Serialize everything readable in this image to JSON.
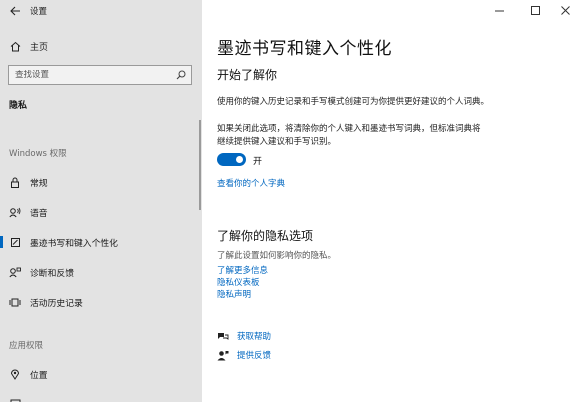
{
  "app": {
    "title": "设置"
  },
  "sidebar": {
    "home_label": "主页",
    "search_placeholder": "查找设置",
    "current_section": "隐私",
    "group_windows": "Windows 权限",
    "items": [
      {
        "label": "常规",
        "icon": "lock-icon"
      },
      {
        "label": "语音",
        "icon": "speech-icon"
      },
      {
        "label": "墨迹书写和键入个性化",
        "icon": "ink-icon",
        "active": true
      },
      {
        "label": "诊断和反馈",
        "icon": "diagnostics-icon"
      },
      {
        "label": "活动历史记录",
        "icon": "activity-history-icon"
      }
    ],
    "group_app": "应用权限",
    "app_items": [
      {
        "label": "位置",
        "icon": "location-icon"
      }
    ]
  },
  "main": {
    "title": "墨迹书写和键入个性化",
    "getting_to_know": {
      "title": "开始了解你",
      "desc1": "使用你的键入历史记录和手写模式创建可为你提供更好建议的个人词典。",
      "desc2_line1": "如果关闭此选项，将清除你的个人键入和墨迹书写词典，但标准词典将",
      "desc2_line2": "继续提供键入建议和手写识别。",
      "toggle_state": "开",
      "toggle_on": true,
      "link": "查看你的个人字典"
    },
    "privacy": {
      "title": "了解你的隐私选项",
      "desc": "了解此设置如何影响你的隐私。",
      "links": [
        "了解更多信息",
        "隐私仪表板",
        "隐私声明"
      ]
    },
    "help": {
      "get_help": "获取帮助",
      "feedback": "提供反馈"
    }
  },
  "colors": {
    "accent": "#0067c0",
    "sidebar_bg": "#e3e3e3"
  }
}
